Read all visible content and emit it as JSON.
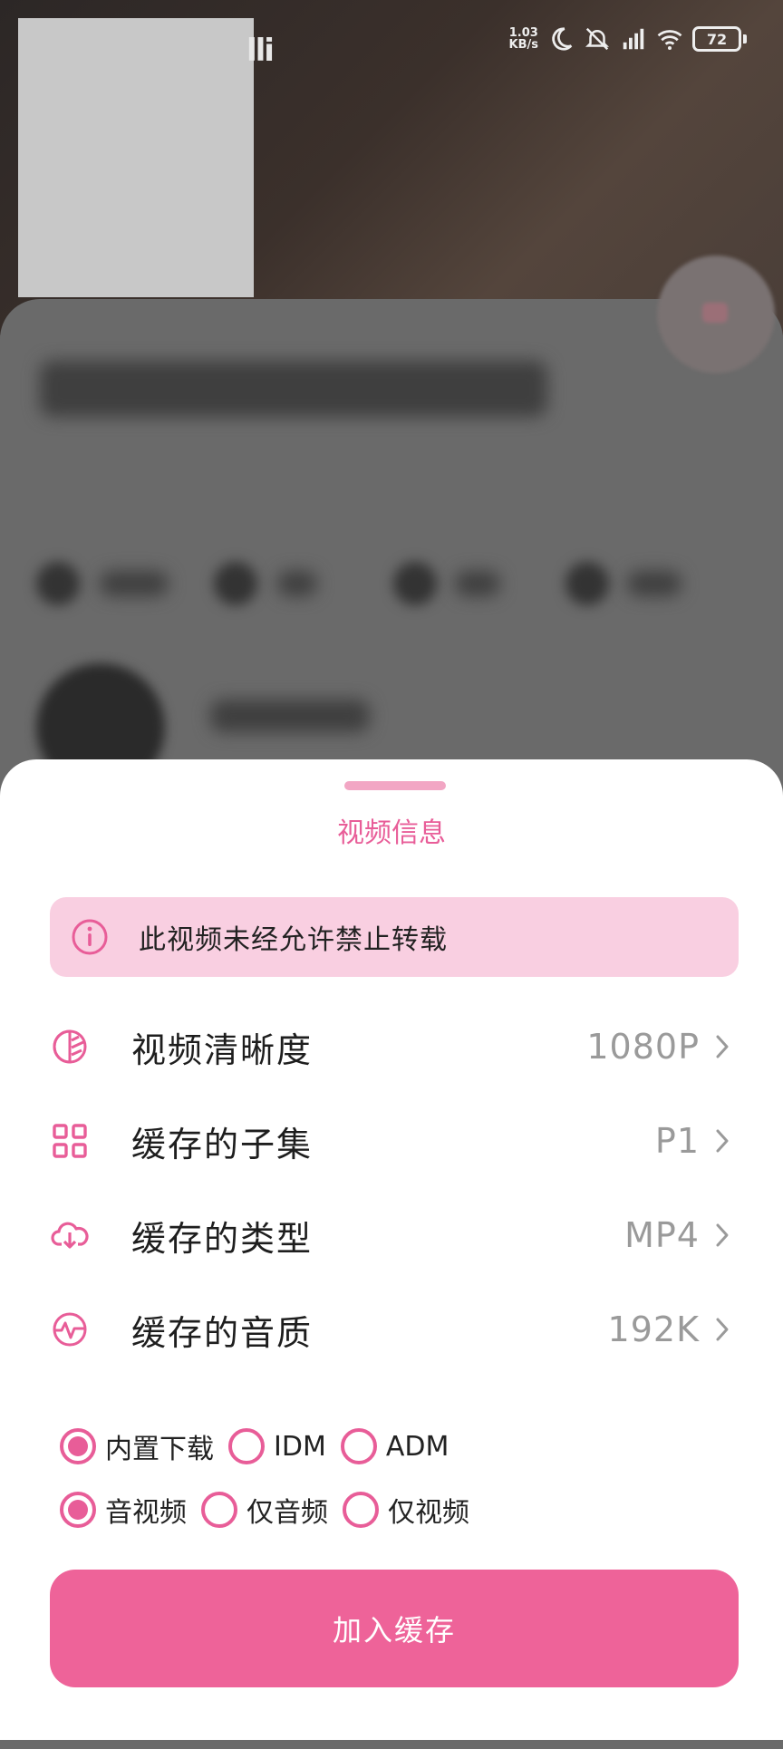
{
  "status_bar": {
    "net_speed_value": "1.03",
    "net_speed_unit": "KB/s",
    "battery": "72",
    "icons": [
      "moon-icon",
      "mute-icon",
      "signal-icon",
      "wifi-icon",
      "battery-icon"
    ]
  },
  "background": {
    "logo_fragment": "lli"
  },
  "sheet": {
    "title": "视频信息",
    "notice": "此视频未经允许禁止转载",
    "settings": [
      {
        "label": "视频清晰度",
        "value": "1080P",
        "icon": "quality-icon"
      },
      {
        "label": "缓存的子集",
        "value": "P1",
        "icon": "grid-icon"
      },
      {
        "label": "缓存的类型",
        "value": "MP4",
        "icon": "cloud-download-icon"
      },
      {
        "label": "缓存的音质",
        "value": "192K",
        "icon": "audio-wave-icon"
      }
    ],
    "downloader_options": [
      {
        "label": "内置下载",
        "selected": true
      },
      {
        "label": "IDM",
        "selected": false
      },
      {
        "label": "ADM",
        "selected": false
      }
    ],
    "content_options": [
      {
        "label": "音视频",
        "selected": true
      },
      {
        "label": "仅音频",
        "selected": false
      },
      {
        "label": "仅视频",
        "selected": false
      }
    ],
    "primary_button": "加入缓存"
  },
  "colors": {
    "accent": "#e85d98",
    "notice_bg": "#f9cfe1",
    "button_bg": "#ee6399"
  }
}
